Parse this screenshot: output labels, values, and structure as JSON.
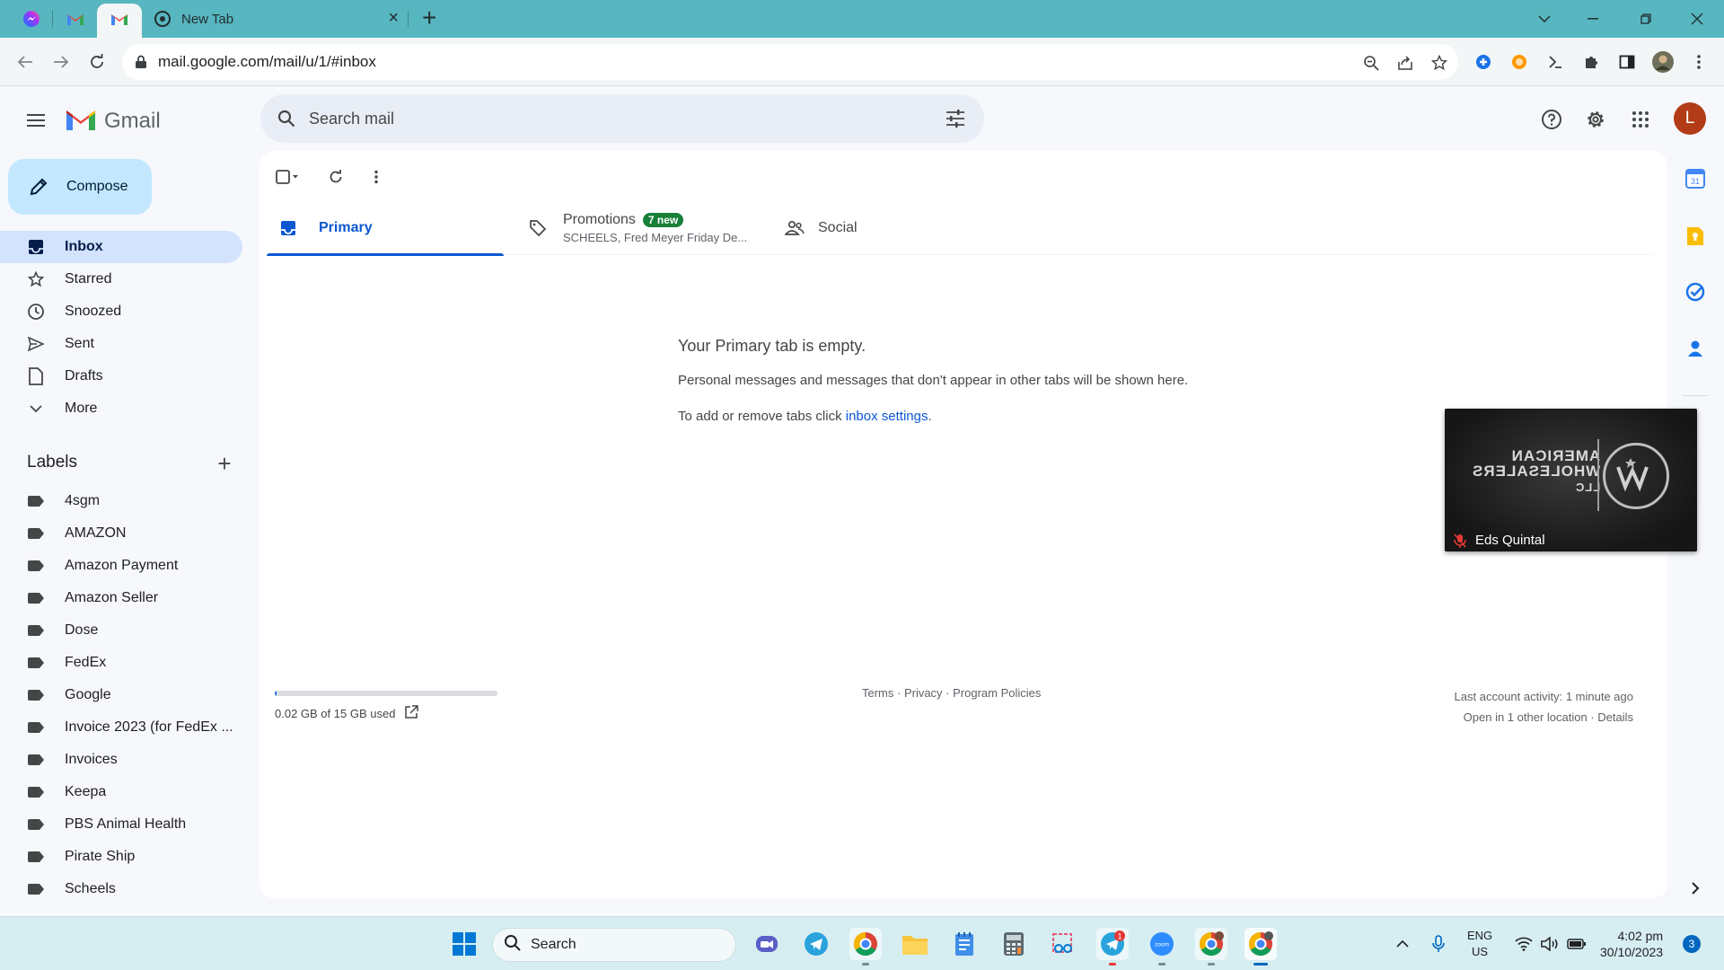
{
  "browser": {
    "tabs": [
      {
        "icon": "messenger-icon"
      },
      {
        "icon": "gmail-icon"
      },
      {
        "icon": "gmail-icon",
        "active": true
      },
      {
        "icon": "chrome-icon",
        "title": "New Tab"
      }
    ],
    "new_tab_symbol": "+",
    "url": "mail.google.com/mail/u/1/#inbox"
  },
  "gmail": {
    "logo_text": "Gmail",
    "search_placeholder": "Search mail",
    "avatar_letter": "L",
    "compose_label": "Compose",
    "nav": [
      {
        "label": "Inbox",
        "icon": "inbox-icon",
        "active": true
      },
      {
        "label": "Starred",
        "icon": "star-icon"
      },
      {
        "label": "Snoozed",
        "icon": "clock-icon"
      },
      {
        "label": "Sent",
        "icon": "send-icon"
      },
      {
        "label": "Drafts",
        "icon": "draft-icon"
      },
      {
        "label": "More",
        "icon": "chevron-down-icon"
      }
    ],
    "labels_title": "Labels",
    "labels": [
      "4sgm",
      "AMAZON",
      "Amazon Payment",
      "Amazon Seller",
      "Dose",
      "FedEx",
      "Google",
      "Invoice 2023 (for FedEx ...",
      "Invoices",
      "Keepa",
      "PBS Animal Health",
      "Pirate Ship",
      "Scheels"
    ],
    "category_tabs": {
      "primary": "Primary",
      "promotions": "Promotions",
      "promotions_badge": "7 new",
      "promotions_snippet": "SCHEELS, Fred Meyer Friday De...",
      "social": "Social"
    },
    "empty": {
      "title": "Your Primary tab is empty.",
      "description": "Personal messages and messages that don't appear in other tabs will be shown here.",
      "hint_prefix": "To add or remove tabs click ",
      "hint_link": "inbox settings",
      "hint_suffix": "."
    },
    "footer": {
      "storage_text": "0.02 GB of 15 GB used",
      "storage_fraction": 0.0013,
      "links": "Terms · Privacy · Program Policies",
      "activity": "Last account activity: 1 minute ago",
      "location_prefix": "Open in 1 other location · ",
      "details_link": "Details"
    }
  },
  "video_overlay": {
    "participant": "Eds Quintal",
    "logo_text": "THE AMERICAN WHOLESALERS LLC"
  },
  "taskbar": {
    "search_label": "Search",
    "telegram_badge": "1",
    "language": "ENG",
    "region": "US",
    "time": "4:02 pm",
    "date": "30/10/2023",
    "notifications": "3"
  },
  "colors": {
    "tabbar": "#58b6c0",
    "compose": "#c2e7ff",
    "active_nav": "#d3e3fd",
    "accent": "#0b57d0",
    "badge": "#188038",
    "avatar": "#b23c17"
  }
}
